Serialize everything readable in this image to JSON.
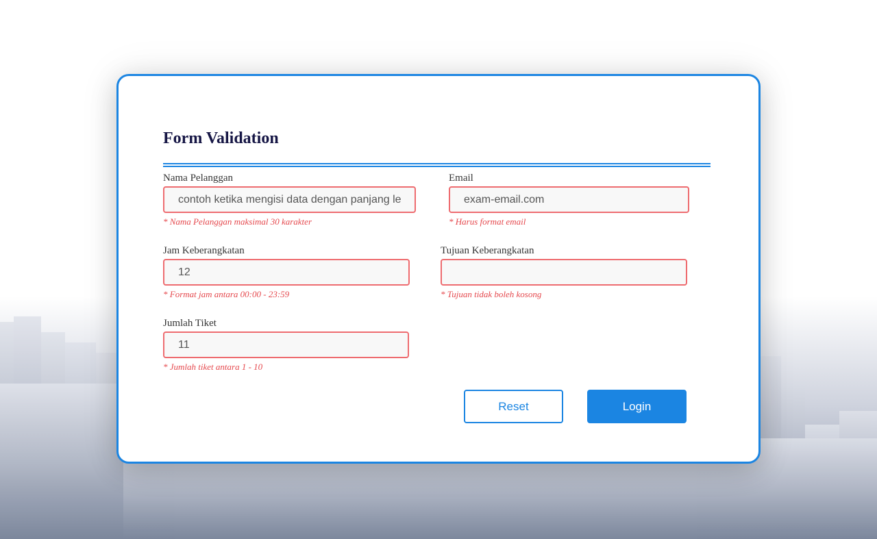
{
  "colors": {
    "accent": "#1b85e2",
    "error": "#e5484d",
    "input_error_border": "#ee6b6f",
    "title": "#161645"
  },
  "form": {
    "title": "Form Validation",
    "fields": {
      "nama": {
        "label": "Nama Pelanggan",
        "value": "contoh ketika mengisi data dengan panjang le",
        "error": "* Nama Pelanggan maksimal 30 karakter"
      },
      "email": {
        "label": "Email",
        "value": "exam-email.com",
        "error": "* Harus format email"
      },
      "jam": {
        "label": "Jam Keberangkatan",
        "value": "12",
        "error": "* Format jam antara 00:00 - 23:59"
      },
      "tujuan": {
        "label": "Tujuan Keberangkatan",
        "value": "",
        "error": "* Tujuan tidak boleh kosong"
      },
      "tiket": {
        "label": "Jumlah Tiket",
        "value": "11",
        "error": "* Jumlah tiket antara 1 - 10"
      }
    },
    "buttons": {
      "reset": "Reset",
      "login": "Login"
    }
  }
}
